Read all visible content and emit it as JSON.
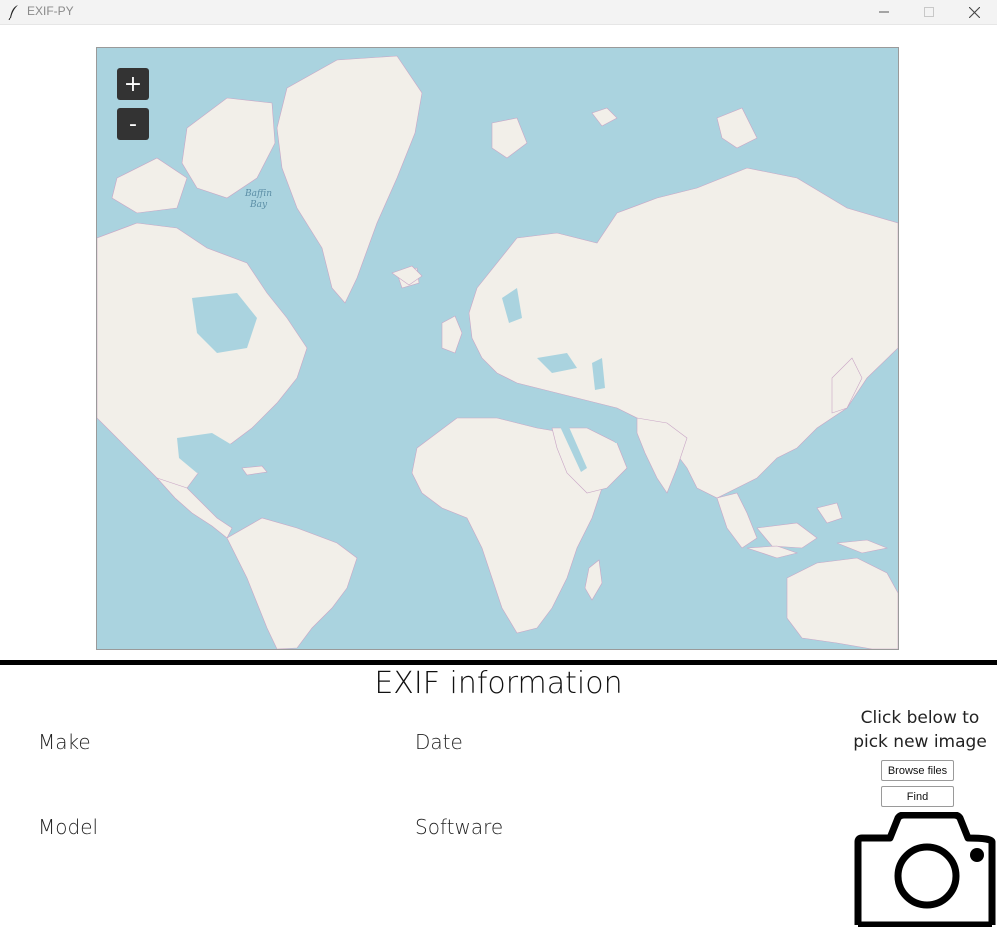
{
  "window": {
    "title": "EXIF-PY"
  },
  "map": {
    "zoom_in_label": "+",
    "zoom_out_label": "-",
    "labels": {
      "baffin_bay": "Baffin\nBay"
    },
    "colors": {
      "water": "#aad3df",
      "land": "#f2efe9",
      "border": "#c9a6c6"
    }
  },
  "exif": {
    "title": "EXIF information",
    "fields": {
      "make": "Make",
      "date": "Date",
      "model": "Model",
      "software": "Software"
    }
  },
  "picker": {
    "hint": "Click below to pick new image",
    "browse_label": "Browse files",
    "find_label": "Find"
  },
  "icons": {
    "app": "feather-icon",
    "minimize": "minimize-icon",
    "maximize": "maximize-icon",
    "close": "close-icon",
    "camera": "camera-icon"
  }
}
